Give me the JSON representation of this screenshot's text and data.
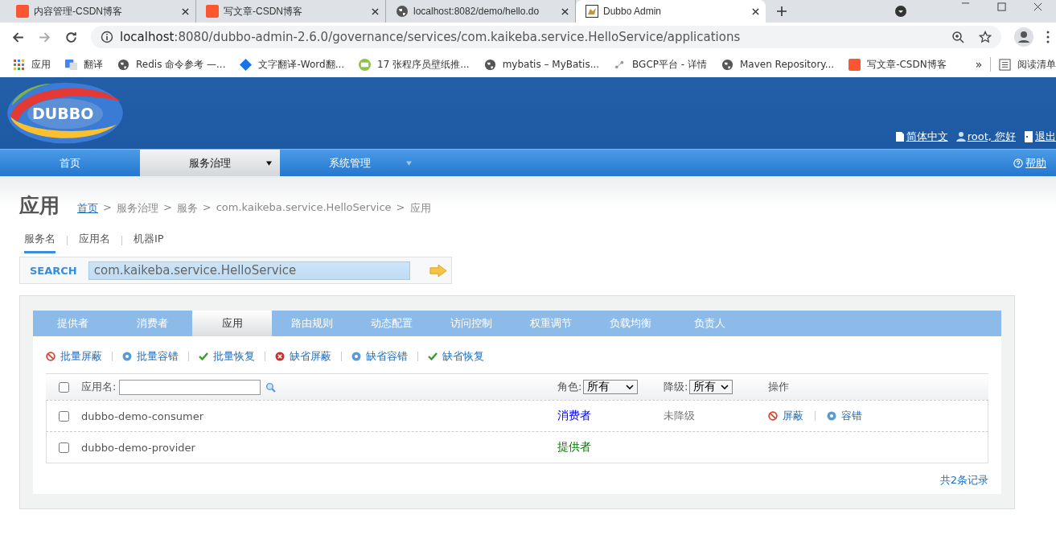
{
  "browser": {
    "tabs": [
      {
        "title": "内容管理-CSDN博客",
        "kind": "csdn",
        "selected": false
      },
      {
        "title": "写文章-CSDN博客",
        "kind": "csdn",
        "selected": false
      },
      {
        "title": "localhost:8082/demo/hello.do",
        "kind": "globe",
        "selected": false
      },
      {
        "title": "Dubbo Admin",
        "kind": "app",
        "selected": true
      }
    ],
    "address": {
      "host": "localhost",
      "rest": ":8080/dubbo-admin-2.6.0/governance/services/com.kaikeba.service.HelloService/applications"
    },
    "bookmarks": [
      {
        "label": "应用",
        "kind": "apps"
      },
      {
        "label": "翻译",
        "kind": "translate"
      },
      {
        "label": "Redis 命令参考 —...",
        "kind": "globe"
      },
      {
        "label": "文字翻译-Word翻...",
        "kind": "diamond"
      },
      {
        "label": "17 张程序员壁纸推...",
        "kind": "code"
      },
      {
        "label": "mybatis – MyBatis...",
        "kind": "globe"
      },
      {
        "label": "BGCP平台 - 详情",
        "kind": "share"
      },
      {
        "label": "Maven Repository...",
        "kind": "globe"
      },
      {
        "label": "写文章-CSDN博客",
        "kind": "csdn"
      }
    ],
    "overflow": "»",
    "reading_list": "阅读清单"
  },
  "header": {
    "logo": "DUBBO",
    "links": [
      {
        "label": "简体中文",
        "kind": "doc"
      },
      {
        "label": "root, 您好",
        "kind": "user"
      },
      {
        "label": "退出",
        "kind": "exit"
      }
    ]
  },
  "nav": {
    "items": [
      {
        "label": "首页",
        "selected": false,
        "dropdown": false
      },
      {
        "label": "服务治理",
        "selected": true,
        "dropdown": true
      },
      {
        "label": "系统管理",
        "selected": false,
        "dropdown": true
      }
    ],
    "help": "帮助"
  },
  "page": {
    "title": "应用",
    "breadcrumb_separator": ">",
    "breadcrumb": [
      {
        "label": "首页",
        "link": true
      },
      {
        "label": "服务治理",
        "link": false
      },
      {
        "label": "服务",
        "link": false
      },
      {
        "label": "com.kaikeba.service.HelloService",
        "link": false
      },
      {
        "label": "应用",
        "link": false
      }
    ],
    "search_tabs": [
      {
        "label": "服务名",
        "selected": true
      },
      {
        "label": "应用名",
        "selected": false
      },
      {
        "label": "机器IP",
        "selected": false
      }
    ],
    "search": {
      "label": "SEARCH",
      "value": "com.kaikeba.service.HelloService"
    }
  },
  "panel": {
    "tabs": [
      {
        "label": "提供者",
        "selected": false
      },
      {
        "label": "消费者",
        "selected": false
      },
      {
        "label": "应用",
        "selected": true
      },
      {
        "label": "路由规则",
        "selected": false
      },
      {
        "label": "动态配置",
        "selected": false
      },
      {
        "label": "访问控制",
        "selected": false
      },
      {
        "label": "权重调节",
        "selected": false
      },
      {
        "label": "负载均衡",
        "selected": false
      },
      {
        "label": "负责人",
        "selected": false
      }
    ],
    "actions": [
      {
        "label": "批量屏蔽",
        "kind": "ban"
      },
      {
        "label": "批量容错",
        "kind": "gear"
      },
      {
        "label": "批量恢复",
        "kind": "check"
      },
      {
        "label": "缺省屏蔽",
        "kind": "error"
      },
      {
        "label": "缺省容错",
        "kind": "gear"
      },
      {
        "label": "缺省恢复",
        "kind": "check"
      }
    ],
    "table": {
      "name_label": "应用名:",
      "role_label": "角色:",
      "role_filter": "所有",
      "degrade_label": "降级:",
      "degrade_filter": "所有",
      "ops_label": "操作",
      "select_all": false,
      "rows": [
        {
          "checked": false,
          "name": "dubbo-demo-consumer",
          "role": "消费者",
          "color": "#0000ff",
          "degrade": "未降级",
          "ops": [
            {
              "label": "屏蔽",
              "kind": "ban"
            },
            {
              "label": "容错",
              "kind": "gear"
            }
          ]
        },
        {
          "checked": false,
          "name": "dubbo-demo-provider",
          "role": "提供者",
          "color": "#008000"
        }
      ]
    },
    "total": "共2条记录"
  }
}
